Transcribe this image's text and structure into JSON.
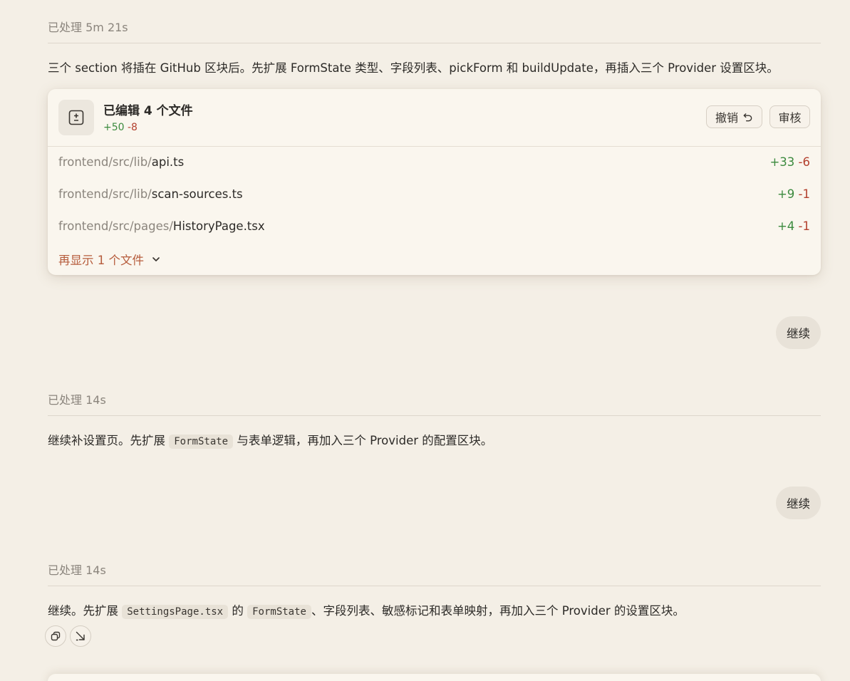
{
  "block1": {
    "header": "已处理 5m 21s",
    "message": "三个 section 将插在 GitHub 区块后。先扩展 FormState 类型、字段列表、pickForm 和 buildUpdate，再插入三个 Provider 设置区块。"
  },
  "card": {
    "title": "已编辑 4 个文件",
    "additions": "+50",
    "deletions": "-8",
    "undo_label": "撤销",
    "review_label": "审核",
    "files": [
      {
        "path": "frontend/src/lib/",
        "name": "api.ts",
        "additions": "+33",
        "deletions": "-6"
      },
      {
        "path": "frontend/src/lib/",
        "name": "scan-sources.ts",
        "additions": "+9",
        "deletions": "-1"
      },
      {
        "path": "frontend/src/pages/",
        "name": "HistoryPage.tsx",
        "additions": "+4",
        "deletions": "-1"
      }
    ],
    "show_more": "再显示 1 个文件"
  },
  "user_msg1": "继续",
  "block2": {
    "header": "已处理 14s",
    "msg_before": "继续补设置页。先扩展 ",
    "code1": "FormState",
    "msg_after": " 与表单逻辑，再加入三个 Provider 的配置区块。"
  },
  "user_msg2": "继续",
  "block3": {
    "header": "已处理 14s",
    "msg_part1": "继续。先扩展 ",
    "code1": "SettingsPage.tsx",
    "msg_part2": " 的 ",
    "code2": "FormState",
    "msg_part3": "、字段列表、敏感标记和表单映射，再加入三个 Provider 的设置区块。"
  },
  "actions": {
    "copy_icon": "copy-icon",
    "open_icon": "open-external-icon"
  },
  "colors": {
    "background": "#f4efe6",
    "card": "#faf6ee",
    "additions": "#3b8a3e",
    "deletions": "#b3402e",
    "link": "#b65c3c"
  }
}
